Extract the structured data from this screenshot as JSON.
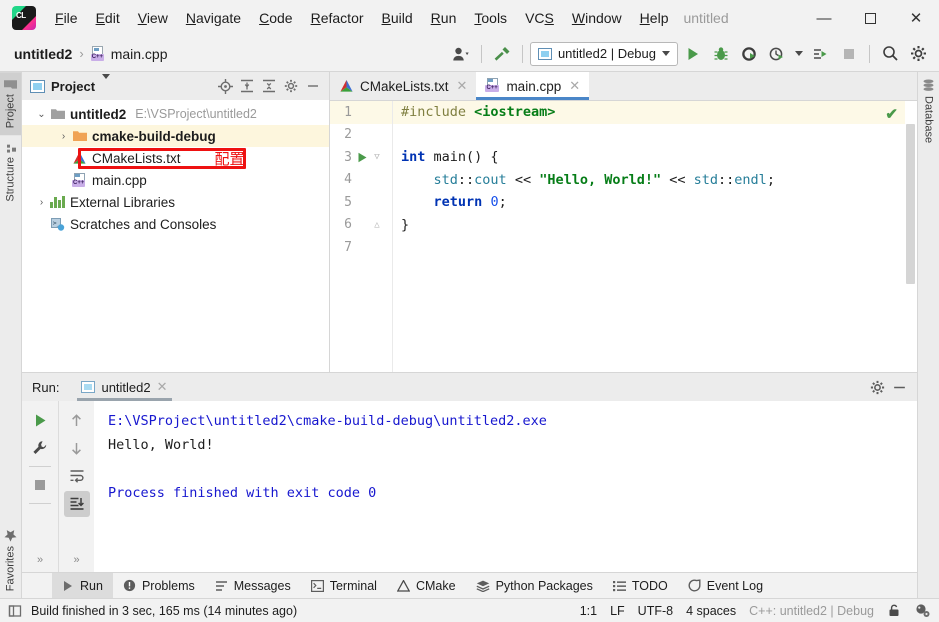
{
  "window": {
    "title": "untitled",
    "minimize_label": "—",
    "maximize_label": "☐",
    "close_label": "✕"
  },
  "menubar": {
    "items": [
      {
        "pre": "",
        "mn": "F",
        "post": "ile"
      },
      {
        "pre": "",
        "mn": "E",
        "post": "dit"
      },
      {
        "pre": "",
        "mn": "V",
        "post": "iew"
      },
      {
        "pre": "",
        "mn": "N",
        "post": "avigate"
      },
      {
        "pre": "",
        "mn": "C",
        "post": "ode"
      },
      {
        "pre": "",
        "mn": "R",
        "post": "efactor"
      },
      {
        "pre": "",
        "mn": "B",
        "post": "uild"
      },
      {
        "pre": "",
        "mn": "R",
        "post": "un"
      },
      {
        "pre": "",
        "mn": "T",
        "post": "ools"
      },
      {
        "pre": "VC",
        "mn": "S",
        "post": ""
      },
      {
        "pre": "",
        "mn": "W",
        "post": "indow"
      },
      {
        "pre": "",
        "mn": "H",
        "post": "elp"
      }
    ]
  },
  "toolbar": {
    "breadcrumb_project": "untitled2",
    "breadcrumb_sep": "›",
    "breadcrumb_file": "main.cpp",
    "cpp_badge": "C++",
    "run_config": "untitled2 | Debug",
    "icons": {
      "user": "user-avatar-icon",
      "build": "hammer-build-icon",
      "run": "run-icon",
      "debug": "debug-icon",
      "coverage": "run-with-coverage-icon",
      "profile": "profile-icon",
      "attach": "attach-to-process-icon",
      "stop": "stop-icon",
      "search": "search-icon",
      "settings": "gear-icon"
    }
  },
  "left_bar": {
    "tabs": [
      {
        "label": "Project",
        "icon": "folder-icon",
        "active": true
      },
      {
        "label": "Structure",
        "icon": "structure-icon",
        "active": false
      }
    ],
    "bottom_tabs": [
      {
        "label": "Favorites",
        "icon": "star-icon",
        "active": false
      }
    ]
  },
  "right_bar": {
    "tabs": [
      {
        "label": "Database",
        "icon": "database-icon",
        "active": false
      }
    ]
  },
  "project_panel": {
    "title": "Project",
    "icons": {
      "locate": "locate-target-icon",
      "expand": "expand-all-icon",
      "collapse": "collapse-all-icon",
      "settings": "gear-icon",
      "hide": "hide-panel-icon"
    },
    "tree": [
      {
        "label": "untitled2",
        "path": "E:\\VSProject\\untitled2",
        "icon": "folder-icon",
        "arrow": "⌄",
        "depth": 0,
        "bold": true,
        "highlight": false
      },
      {
        "label": "cmake-build-debug",
        "path": "",
        "icon": "folder-orange-icon",
        "arrow": "›",
        "depth": 1,
        "bold": true,
        "highlight": true
      },
      {
        "label": "CMakeLists.txt",
        "path": "",
        "icon": "cmake-icon",
        "arrow": "",
        "depth": 1,
        "bold": false,
        "highlight": false,
        "annotation": "配置",
        "boxed": true
      },
      {
        "label": "main.cpp",
        "path": "",
        "icon": "cpp-file-icon",
        "arrow": "",
        "depth": 1,
        "bold": false,
        "highlight": false
      },
      {
        "label": "External Libraries",
        "path": "",
        "icon": "libraries-icon",
        "arrow": "›",
        "depth": 0,
        "bold": false,
        "highlight": false
      },
      {
        "label": "Scratches and Consoles",
        "path": "",
        "icon": "scratches-icon",
        "arrow": "",
        "depth": 0,
        "bold": false,
        "highlight": false
      }
    ]
  },
  "editor": {
    "tabs": [
      {
        "label": "CMakeLists.txt",
        "icon": "cmake-icon",
        "active": false,
        "close": "✕"
      },
      {
        "label": "main.cpp",
        "icon": "cpp-file-icon",
        "active": true,
        "close": "✕"
      }
    ],
    "inspection_status": "✔",
    "lines": [
      {
        "num": "1",
        "highlight": true,
        "runmark": false,
        "fold": "",
        "tokens": [
          {
            "t": "#include ",
            "c": "pre"
          },
          {
            "t": "<iostream>",
            "c": "hdr"
          }
        ]
      },
      {
        "num": "2",
        "highlight": false,
        "runmark": false,
        "fold": "",
        "tokens": []
      },
      {
        "num": "3",
        "highlight": false,
        "runmark": true,
        "fold": "▽",
        "tokens": [
          {
            "t": "int",
            "c": "kw"
          },
          {
            "t": " main() {",
            "c": ""
          }
        ]
      },
      {
        "num": "4",
        "highlight": false,
        "runmark": false,
        "fold": "",
        "tokens": [
          {
            "t": "    ",
            "c": ""
          },
          {
            "t": "std",
            "c": "ns"
          },
          {
            "t": "::",
            "c": ""
          },
          {
            "t": "cout",
            "c": "ns"
          },
          {
            "t": " << ",
            "c": ""
          },
          {
            "t": "\"Hello, World!\"",
            "c": "str"
          },
          {
            "t": " << ",
            "c": ""
          },
          {
            "t": "std",
            "c": "ns"
          },
          {
            "t": "::",
            "c": ""
          },
          {
            "t": "endl",
            "c": "ns"
          },
          {
            "t": ";",
            "c": ""
          }
        ]
      },
      {
        "num": "5",
        "highlight": false,
        "runmark": false,
        "fold": "",
        "tokens": [
          {
            "t": "    ",
            "c": ""
          },
          {
            "t": "return",
            "c": "kw"
          },
          {
            "t": " ",
            "c": ""
          },
          {
            "t": "0",
            "c": "num0"
          },
          {
            "t": ";",
            "c": ""
          }
        ]
      },
      {
        "num": "6",
        "highlight": false,
        "runmark": false,
        "fold": "△",
        "tokens": [
          {
            "t": "}",
            "c": ""
          }
        ]
      },
      {
        "num": "7",
        "highlight": false,
        "runmark": false,
        "fold": "",
        "tokens": []
      }
    ]
  },
  "run_panel": {
    "label": "Run:",
    "tab_label": "untitled2",
    "tab_close": "✕",
    "head_icons": {
      "settings": "gear-icon",
      "hide": "hide-panel-icon"
    },
    "tool_buttons_left": [
      {
        "name": "rerun-icon",
        "selected": false
      },
      {
        "name": "wrench-settings-icon",
        "selected": false
      },
      {
        "name": "stop-icon",
        "selected": false
      }
    ],
    "tool_buttons_right": [
      {
        "name": "arrow-up-icon",
        "selected": false
      },
      {
        "name": "arrow-down-icon",
        "selected": false
      },
      {
        "name": "soft-wrap-icon",
        "selected": false
      },
      {
        "name": "scroll-to-end-icon",
        "selected": true
      }
    ],
    "expand_chevron": "»",
    "console": [
      {
        "text": "E:\\VSProject\\untitled2\\cmake-build-debug\\untitled2.exe",
        "color": "blue"
      },
      {
        "text": "Hello, World!",
        "color": "black"
      },
      {
        "text": "",
        "color": "black"
      },
      {
        "text": "Process finished with exit code 0",
        "color": "blue"
      }
    ]
  },
  "tool_window_bar": [
    {
      "label": "Run",
      "icon": "run-icon",
      "active": true
    },
    {
      "label": "Problems",
      "icon": "problems-icon",
      "active": false
    },
    {
      "label": "Messages",
      "icon": "messages-icon",
      "active": false
    },
    {
      "label": "Terminal",
      "icon": "terminal-icon",
      "active": false
    },
    {
      "label": "CMake",
      "icon": "cmake-icon",
      "active": false
    },
    {
      "label": "Python Packages",
      "icon": "python-packages-icon",
      "active": false
    },
    {
      "label": "TODO",
      "icon": "todo-icon",
      "active": false
    },
    {
      "label": "Event Log",
      "icon": "event-log-icon",
      "active": false
    }
  ],
  "status_bar": {
    "message": "Build finished in 3 sec, 165 ms (14 minutes ago)",
    "caret_position": "1:1",
    "line_separator": "LF",
    "encoding": "UTF-8",
    "indent": "4 spaces",
    "config": "C++: untitled2 | Debug",
    "icons": {
      "lock": "lock-icon",
      "inspections": "inspections-icon",
      "toggle": "toggle-panel-icon"
    }
  }
}
